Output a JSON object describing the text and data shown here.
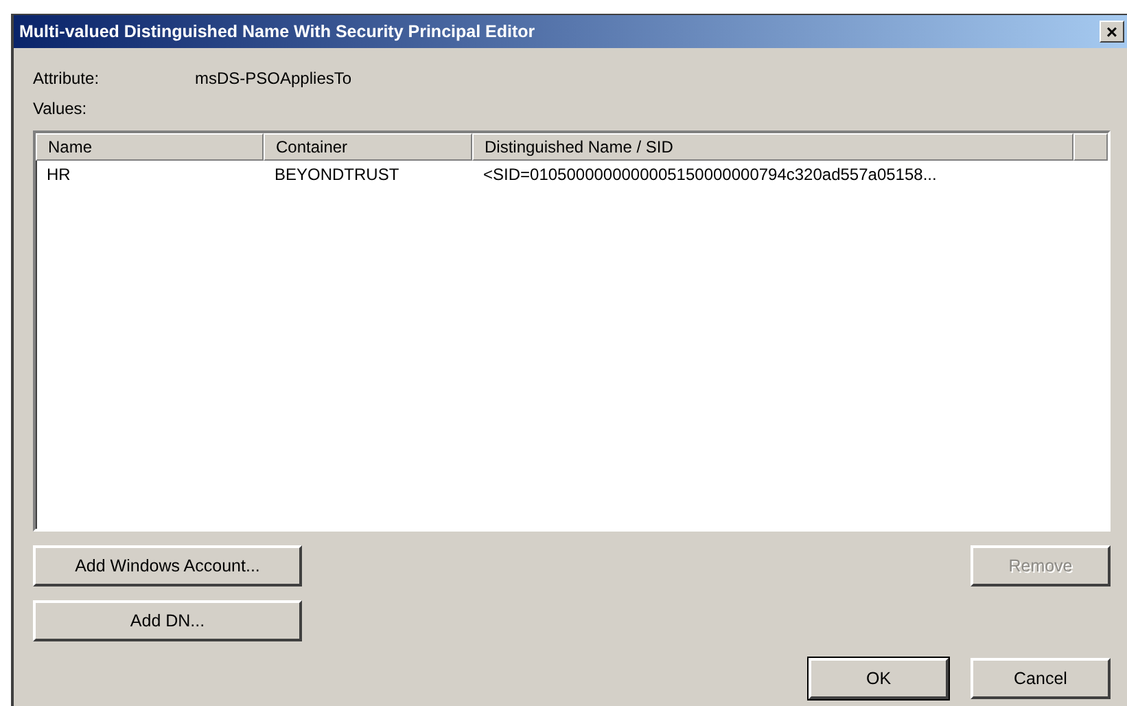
{
  "window": {
    "title": "Multi-valued Distinguished Name With Security Principal Editor",
    "close": "×"
  },
  "attribute": {
    "label": "Attribute:",
    "value": "msDS-PSOAppliesTo"
  },
  "values_label": "Values:",
  "table": {
    "columns": [
      "Name",
      "Container",
      "Distinguished Name / SID"
    ],
    "rows": [
      {
        "cells": [
          "HR",
          "BEYONDTRUST",
          "<SID=0105000000000005150000000794c320ad557a05158..."
        ],
        "selected": false
      }
    ]
  },
  "buttons": [
    {
      "label": "Add Windows Account...",
      "kind": "left",
      "disabled": false,
      "default": false
    },
    {
      "label": "Remove",
      "kind": "right",
      "disabled": true,
      "default": false
    },
    {
      "label": "Add DN...",
      "kind": "left",
      "disabled": false,
      "default": false
    },
    {
      "label": "OK",
      "kind": "bottom",
      "disabled": false,
      "default": true
    },
    {
      "label": "Cancel",
      "kind": "bottom",
      "disabled": false,
      "default": false
    }
  ]
}
